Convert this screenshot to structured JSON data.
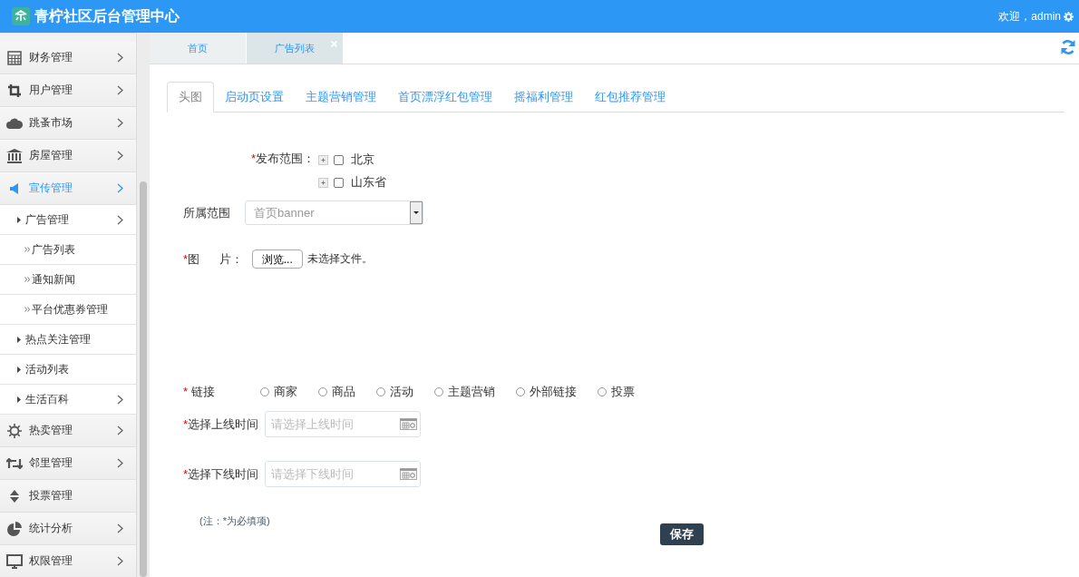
{
  "header": {
    "title": "青柠社区后台管理中心",
    "welcome": "欢迎，admin"
  },
  "sidebar": {
    "items": [
      {
        "label": "财务管理",
        "selected": false,
        "expandable": true
      },
      {
        "label": "用户管理",
        "selected": false,
        "expandable": true
      },
      {
        "label": "跳蚤市场",
        "selected": false,
        "expandable": true
      },
      {
        "label": "房屋管理",
        "selected": false,
        "expandable": true
      },
      {
        "label": "宣传管理",
        "selected": true,
        "expandable": true,
        "children": [
          {
            "label": "广告管理",
            "selected": false,
            "expandable": true,
            "children": [
              {
                "label": "广告列表",
                "selected": false
              },
              {
                "label": "通知新闻",
                "selected": false
              },
              {
                "label": "平台优惠券管理",
                "selected": false
              }
            ]
          },
          {
            "label": "热点关注管理",
            "selected": false,
            "expandable": false
          },
          {
            "label": "活动列表",
            "selected": false,
            "expandable": false
          },
          {
            "label": "生活百科",
            "selected": false,
            "expandable": true
          }
        ]
      },
      {
        "label": "热卖管理",
        "selected": false,
        "expandable": true
      },
      {
        "label": "邻里管理",
        "selected": false,
        "expandable": true
      },
      {
        "label": "投票管理",
        "selected": false,
        "expandable": false
      },
      {
        "label": "统计分析",
        "selected": false,
        "expandable": true
      },
      {
        "label": "权限管理",
        "selected": false,
        "expandable": true
      }
    ]
  },
  "page_tabs": [
    {
      "label": "首页",
      "selected": false,
      "closable": false
    },
    {
      "label": "广告列表",
      "selected": true,
      "closable": true
    }
  ],
  "section_tabs": [
    {
      "label": "头图",
      "selected": true
    },
    {
      "label": "启动页设置",
      "selected": false
    },
    {
      "label": "主题营销管理",
      "selected": false
    },
    {
      "label": "首页漂浮红包管理",
      "selected": false
    },
    {
      "label": "摇福利管理",
      "selected": false
    },
    {
      "label": "红包推荐管理",
      "selected": false
    }
  ],
  "form": {
    "scope": {
      "required_mark": "*",
      "label": "发布范围：",
      "options": [
        {
          "label": "北京",
          "checked": false
        },
        {
          "label": "山东省",
          "checked": false
        }
      ]
    },
    "category": {
      "label": "所属范围",
      "value": "首页banner"
    },
    "image": {
      "required_mark": "*",
      "label": "图      片：",
      "button": "浏览...",
      "status": "未选择文件。"
    },
    "link": {
      "required_mark": "*",
      "label": " 链接",
      "options": [
        {
          "label": "商家",
          "selected": false
        },
        {
          "label": "商品",
          "selected": false
        },
        {
          "label": "活动",
          "selected": false
        },
        {
          "label": "主题营销",
          "selected": false
        },
        {
          "label": "外部链接",
          "selected": false
        },
        {
          "label": "投票",
          "selected": false
        }
      ]
    },
    "start_time": {
      "required_mark": "*",
      "label": "选择上线时间",
      "placeholder": "请选择上线时间"
    },
    "end_time": {
      "required_mark": "*",
      "label": "选择下线时间",
      "placeholder": "请选择下线时间"
    },
    "note": "(注：*为必填项)",
    "save": "保存"
  }
}
